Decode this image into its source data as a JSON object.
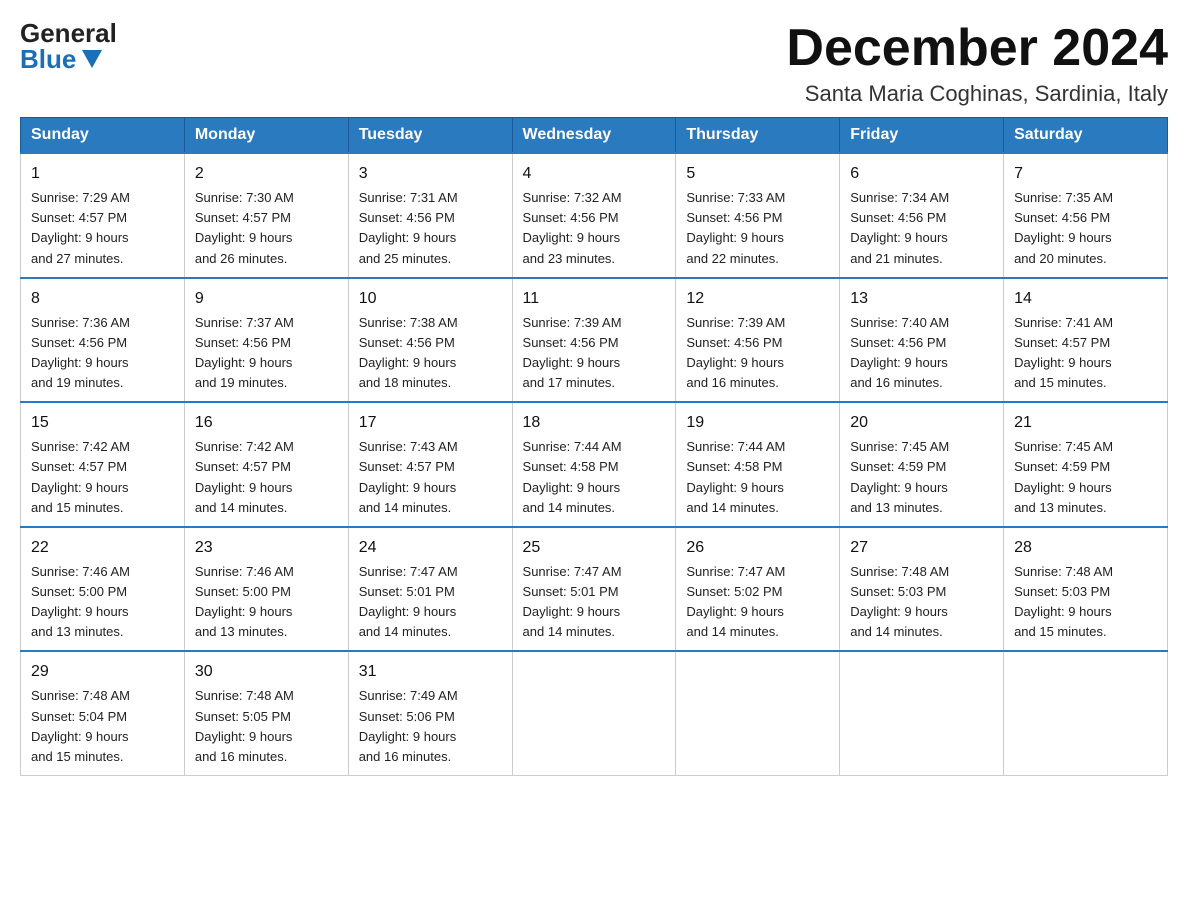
{
  "logo": {
    "general": "General",
    "blue": "Blue"
  },
  "title": "December 2024",
  "location": "Santa Maria Coghinas, Sardinia, Italy",
  "days_of_week": [
    "Sunday",
    "Monday",
    "Tuesday",
    "Wednesday",
    "Thursday",
    "Friday",
    "Saturday"
  ],
  "weeks": [
    [
      {
        "day": "1",
        "sunrise": "7:29 AM",
        "sunset": "4:57 PM",
        "daylight": "9 hours and 27 minutes."
      },
      {
        "day": "2",
        "sunrise": "7:30 AM",
        "sunset": "4:57 PM",
        "daylight": "9 hours and 26 minutes."
      },
      {
        "day": "3",
        "sunrise": "7:31 AM",
        "sunset": "4:56 PM",
        "daylight": "9 hours and 25 minutes."
      },
      {
        "day": "4",
        "sunrise": "7:32 AM",
        "sunset": "4:56 PM",
        "daylight": "9 hours and 23 minutes."
      },
      {
        "day": "5",
        "sunrise": "7:33 AM",
        "sunset": "4:56 PM",
        "daylight": "9 hours and 22 minutes."
      },
      {
        "day": "6",
        "sunrise": "7:34 AM",
        "sunset": "4:56 PM",
        "daylight": "9 hours and 21 minutes."
      },
      {
        "day": "7",
        "sunrise": "7:35 AM",
        "sunset": "4:56 PM",
        "daylight": "9 hours and 20 minutes."
      }
    ],
    [
      {
        "day": "8",
        "sunrise": "7:36 AM",
        "sunset": "4:56 PM",
        "daylight": "9 hours and 19 minutes."
      },
      {
        "day": "9",
        "sunrise": "7:37 AM",
        "sunset": "4:56 PM",
        "daylight": "9 hours and 19 minutes."
      },
      {
        "day": "10",
        "sunrise": "7:38 AM",
        "sunset": "4:56 PM",
        "daylight": "9 hours and 18 minutes."
      },
      {
        "day": "11",
        "sunrise": "7:39 AM",
        "sunset": "4:56 PM",
        "daylight": "9 hours and 17 minutes."
      },
      {
        "day": "12",
        "sunrise": "7:39 AM",
        "sunset": "4:56 PM",
        "daylight": "9 hours and 16 minutes."
      },
      {
        "day": "13",
        "sunrise": "7:40 AM",
        "sunset": "4:56 PM",
        "daylight": "9 hours and 16 minutes."
      },
      {
        "day": "14",
        "sunrise": "7:41 AM",
        "sunset": "4:57 PM",
        "daylight": "9 hours and 15 minutes."
      }
    ],
    [
      {
        "day": "15",
        "sunrise": "7:42 AM",
        "sunset": "4:57 PM",
        "daylight": "9 hours and 15 minutes."
      },
      {
        "day": "16",
        "sunrise": "7:42 AM",
        "sunset": "4:57 PM",
        "daylight": "9 hours and 14 minutes."
      },
      {
        "day": "17",
        "sunrise": "7:43 AM",
        "sunset": "4:57 PM",
        "daylight": "9 hours and 14 minutes."
      },
      {
        "day": "18",
        "sunrise": "7:44 AM",
        "sunset": "4:58 PM",
        "daylight": "9 hours and 14 minutes."
      },
      {
        "day": "19",
        "sunrise": "7:44 AM",
        "sunset": "4:58 PM",
        "daylight": "9 hours and 14 minutes."
      },
      {
        "day": "20",
        "sunrise": "7:45 AM",
        "sunset": "4:59 PM",
        "daylight": "9 hours and 13 minutes."
      },
      {
        "day": "21",
        "sunrise": "7:45 AM",
        "sunset": "4:59 PM",
        "daylight": "9 hours and 13 minutes."
      }
    ],
    [
      {
        "day": "22",
        "sunrise": "7:46 AM",
        "sunset": "5:00 PM",
        "daylight": "9 hours and 13 minutes."
      },
      {
        "day": "23",
        "sunrise": "7:46 AM",
        "sunset": "5:00 PM",
        "daylight": "9 hours and 13 minutes."
      },
      {
        "day": "24",
        "sunrise": "7:47 AM",
        "sunset": "5:01 PM",
        "daylight": "9 hours and 14 minutes."
      },
      {
        "day": "25",
        "sunrise": "7:47 AM",
        "sunset": "5:01 PM",
        "daylight": "9 hours and 14 minutes."
      },
      {
        "day": "26",
        "sunrise": "7:47 AM",
        "sunset": "5:02 PM",
        "daylight": "9 hours and 14 minutes."
      },
      {
        "day": "27",
        "sunrise": "7:48 AM",
        "sunset": "5:03 PM",
        "daylight": "9 hours and 14 minutes."
      },
      {
        "day": "28",
        "sunrise": "7:48 AM",
        "sunset": "5:03 PM",
        "daylight": "9 hours and 15 minutes."
      }
    ],
    [
      {
        "day": "29",
        "sunrise": "7:48 AM",
        "sunset": "5:04 PM",
        "daylight": "9 hours and 15 minutes."
      },
      {
        "day": "30",
        "sunrise": "7:48 AM",
        "sunset": "5:05 PM",
        "daylight": "9 hours and 16 minutes."
      },
      {
        "day": "31",
        "sunrise": "7:49 AM",
        "sunset": "5:06 PM",
        "daylight": "9 hours and 16 minutes."
      },
      null,
      null,
      null,
      null
    ]
  ],
  "labels": {
    "sunrise": "Sunrise:",
    "sunset": "Sunset:",
    "daylight": "Daylight:"
  }
}
